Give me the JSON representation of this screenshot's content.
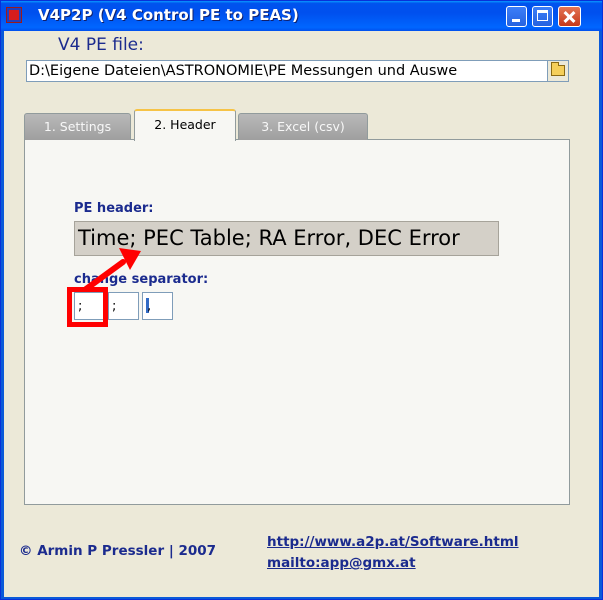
{
  "window": {
    "title": "V4P2P (V4 Control PE to PEAS)"
  },
  "file": {
    "label": "V4 PE file:",
    "path": "D:\\Eigene Dateien\\ASTRONOMIE\\PE Messungen und Auswe"
  },
  "tabs": [
    {
      "label": "1. Settings",
      "active": false
    },
    {
      "label": "2. Header",
      "active": true
    },
    {
      "label": "3. Excel (csv)",
      "active": false
    }
  ],
  "header": {
    "label": "PE header:",
    "value": "Time; PEC Table; RA Error, DEC Error",
    "separator_label": "change separator:",
    "separators": [
      ";",
      ";",
      ","
    ]
  },
  "footer": {
    "copyright": "© Armin P Pressler | 2007",
    "link_web": "http://www.a2p.at/Software.html",
    "link_mail": "mailto:app@gmx.at"
  },
  "colors": {
    "accent": "#1b2b8e",
    "highlight": "#ff0000",
    "tab_active_border": "#f6c346"
  }
}
